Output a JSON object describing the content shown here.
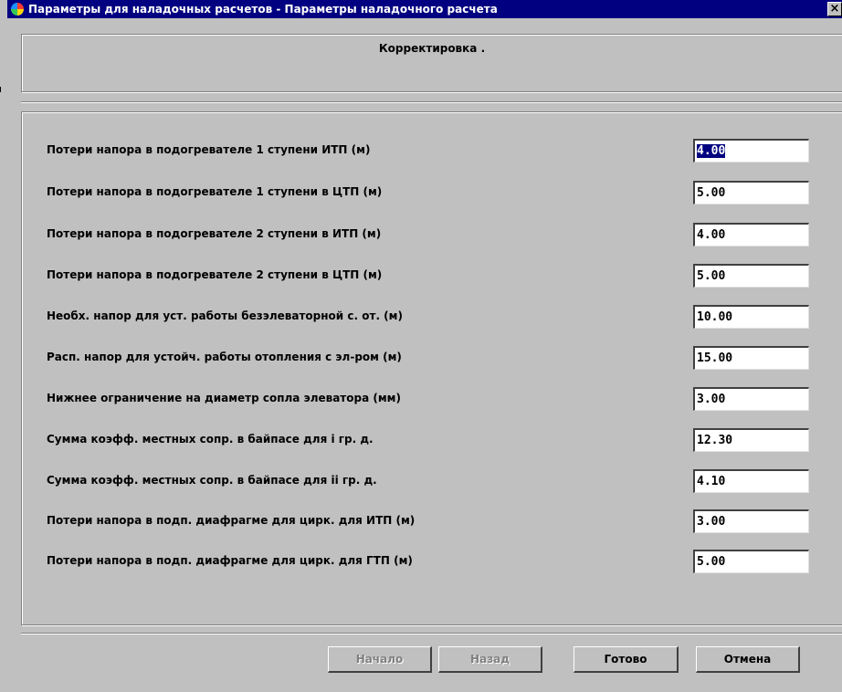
{
  "window": {
    "title": "Параметры для наладочных расчетов - Параметры наладочного расчета",
    "close_glyph": "×"
  },
  "header": {
    "title": "Корректировка ."
  },
  "params": [
    {
      "label": "Потери напора в подогревателе 1 ступени ИТП (м)",
      "value": "4.00",
      "selected": true
    },
    {
      "label": "Потери напора в подогревателе 1 ступени в ЦТП (м)",
      "value": "5.00"
    },
    {
      "label": "Потери напора в подогревателе 2 ступени в ИТП (м)",
      "value": "4.00"
    },
    {
      "label": "Потери напора в подогревателе 2 ступени в ЦТП (м)",
      "value": "5.00"
    },
    {
      "label": "Необх. напор для уст. работы безэлеваторной с. от. (м)",
      "value": "10.00"
    },
    {
      "label": "Расп. напор для устойч. работы отопления с эл-ром (м)",
      "value": "15.00"
    },
    {
      "label": "Нижнее ограничение на диаметр сопла элеватора (мм)",
      "value": "3.00"
    },
    {
      "label": "Сумма коэфф. местных сопр. в байпасе для i гр. д.",
      "value": "12.30"
    },
    {
      "label": "Сумма коэфф. местных сопр. в байпасе для ii гр. д.",
      "value": "4.10"
    },
    {
      "label": "Потери напора в подп. диафрагме для цирк. для ИТП (м)",
      "value": "3.00"
    },
    {
      "label": "Потери напора в подп. диафрагме для цирк. для ГТП (м)",
      "value": "5.00"
    }
  ],
  "buttons": {
    "start": "Начало",
    "back": "Назад",
    "done": "Готово",
    "cancel": "Отмена"
  }
}
